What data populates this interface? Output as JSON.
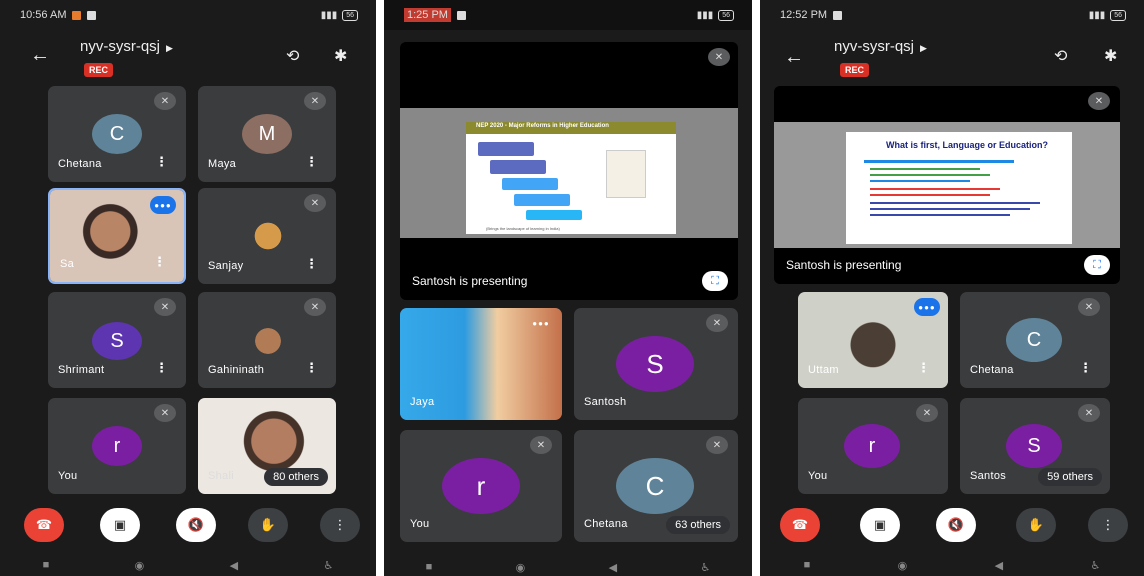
{
  "screen1": {
    "status": {
      "time": "10:56 AM",
      "battery": "56"
    },
    "meeting": {
      "code": "nyv-sysr-qsj",
      "rec": "REC"
    },
    "tiles": [
      {
        "name": "Chetana",
        "initial": "C",
        "color": "#5f8499"
      },
      {
        "name": "Maya",
        "initial": "M",
        "color": "#8d6e63"
      },
      {
        "name": "Sa"
      },
      {
        "name": "Sanjay"
      },
      {
        "name": "Shrimant",
        "initial": "S",
        "color": "#5e35b1"
      },
      {
        "name": "Gahininath"
      },
      {
        "name": "You",
        "initial": "r",
        "color": "#7b1fa2"
      },
      {
        "name": "Shali",
        "others": "80 others"
      }
    ]
  },
  "screen2": {
    "status": {
      "time": "1:25 PM",
      "battery": "56"
    },
    "presentation": {
      "presenter": "Santosh is presenting",
      "slide_title": "NEP 2020 - Major Reforms in Higher Education",
      "slide_footer": "(Brings the landscape of learning in India)"
    },
    "tiles": [
      {
        "name": "Jaya"
      },
      {
        "name": "Santosh",
        "initial": "S",
        "color": "#7b1fa2"
      },
      {
        "name": "You",
        "initial": "r",
        "color": "#7b1fa2"
      },
      {
        "name": "Chetana",
        "initial": "C",
        "color": "#5f8499",
        "others": "63 others"
      }
    ]
  },
  "screen3": {
    "status": {
      "time": "12:52 PM",
      "battery": "56"
    },
    "meeting": {
      "code": "nyv-sysr-qsj",
      "rec": "REC"
    },
    "presentation": {
      "presenter": "Santosh is presenting",
      "slide_title": "What is first, Language or Education?"
    },
    "tiles": [
      {
        "name": "Uttam"
      },
      {
        "name": "Chetana",
        "initial": "C",
        "color": "#5f8499"
      },
      {
        "name": "You",
        "initial": "r",
        "color": "#7b1fa2"
      },
      {
        "name": "Santos",
        "initial": "S",
        "color": "#7b1fa2",
        "others": "59 others"
      }
    ]
  },
  "icons": {
    "back": "←",
    "camera_switch": "⟲",
    "bluetooth": "✱",
    "mic_off": "🔇",
    "more": "⋮",
    "end_call": "☎",
    "cam_off": "▣",
    "raise_hand": "✋",
    "fullscreen": "⛶",
    "nav_square": "■",
    "nav_circle": "◉",
    "nav_back": "◀",
    "nav_person": "♿"
  }
}
